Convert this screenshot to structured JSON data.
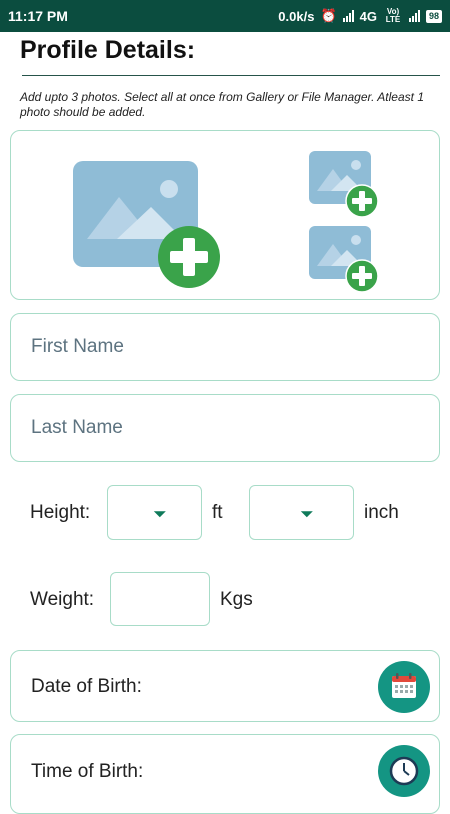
{
  "status_bar": {
    "time": "11:17 PM",
    "net_speed": "0.0k/s",
    "network": "4G",
    "volte": "Vo) LTE",
    "battery": "98"
  },
  "page": {
    "title": "Profile Details:",
    "photo_hint": "Add upto 3 photos. Select all at once from Gallery or File Manager. Atleast 1 photo should be added."
  },
  "form": {
    "first_name_placeholder": "First Name",
    "last_name_placeholder": "Last Name",
    "height_label": "Height:",
    "height_ft_unit": "ft",
    "height_inch_unit": "inch",
    "weight_label": "Weight:",
    "weight_unit": "Kgs",
    "dob_label": "Date of Birth:",
    "tob_label": "Time of Birth:"
  },
  "icons": {
    "photo_placeholder": "image-icon",
    "add": "plus-icon",
    "calendar": "calendar-icon",
    "clock": "clock-icon"
  },
  "colors": {
    "status_bar": "#0b4d3f",
    "border": "#a8dcc8",
    "accent": "#149583",
    "add_green": "#3aa34a",
    "image_blue": "#8fbcd6"
  }
}
